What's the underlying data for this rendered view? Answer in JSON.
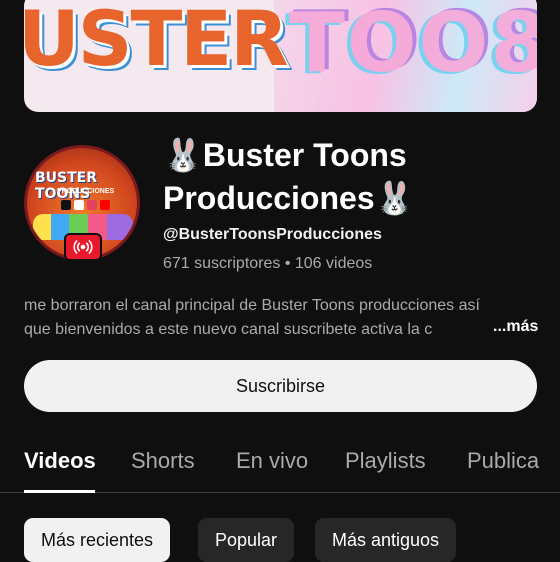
{
  "channel": {
    "name": "🐰Buster Toons Producciones🐰",
    "handle": "@BusterToonsProducciones",
    "stats": "671 suscriptores • 106 videos",
    "description_line1": "me borraron el canal principal de Buster Toons producciones así",
    "description_line2": "que bienvenidos a este nuevo canal suscribete activa la c",
    "more_label": "...más",
    "banner_text": "USTER",
    "avatar_text": "BUSTER TOONS",
    "avatar_subtext": "PRODUCCIONES"
  },
  "subscribe_label": "Suscribirse",
  "tabs": [
    {
      "label": "Videos",
      "active": true
    },
    {
      "label": "Shorts",
      "active": false
    },
    {
      "label": "En vivo",
      "active": false
    },
    {
      "label": "Playlists",
      "active": false
    },
    {
      "label": "Publica",
      "active": false
    }
  ],
  "chips": [
    {
      "label": "Más recientes",
      "selected": true
    },
    {
      "label": "Popular",
      "selected": false
    },
    {
      "label": "Más antiguos",
      "selected": false
    }
  ],
  "colors": {
    "background": "#0f0f0f",
    "live_badge": "#e8192c",
    "chip_selected": "#f1f1f1",
    "chip": "#272727"
  }
}
